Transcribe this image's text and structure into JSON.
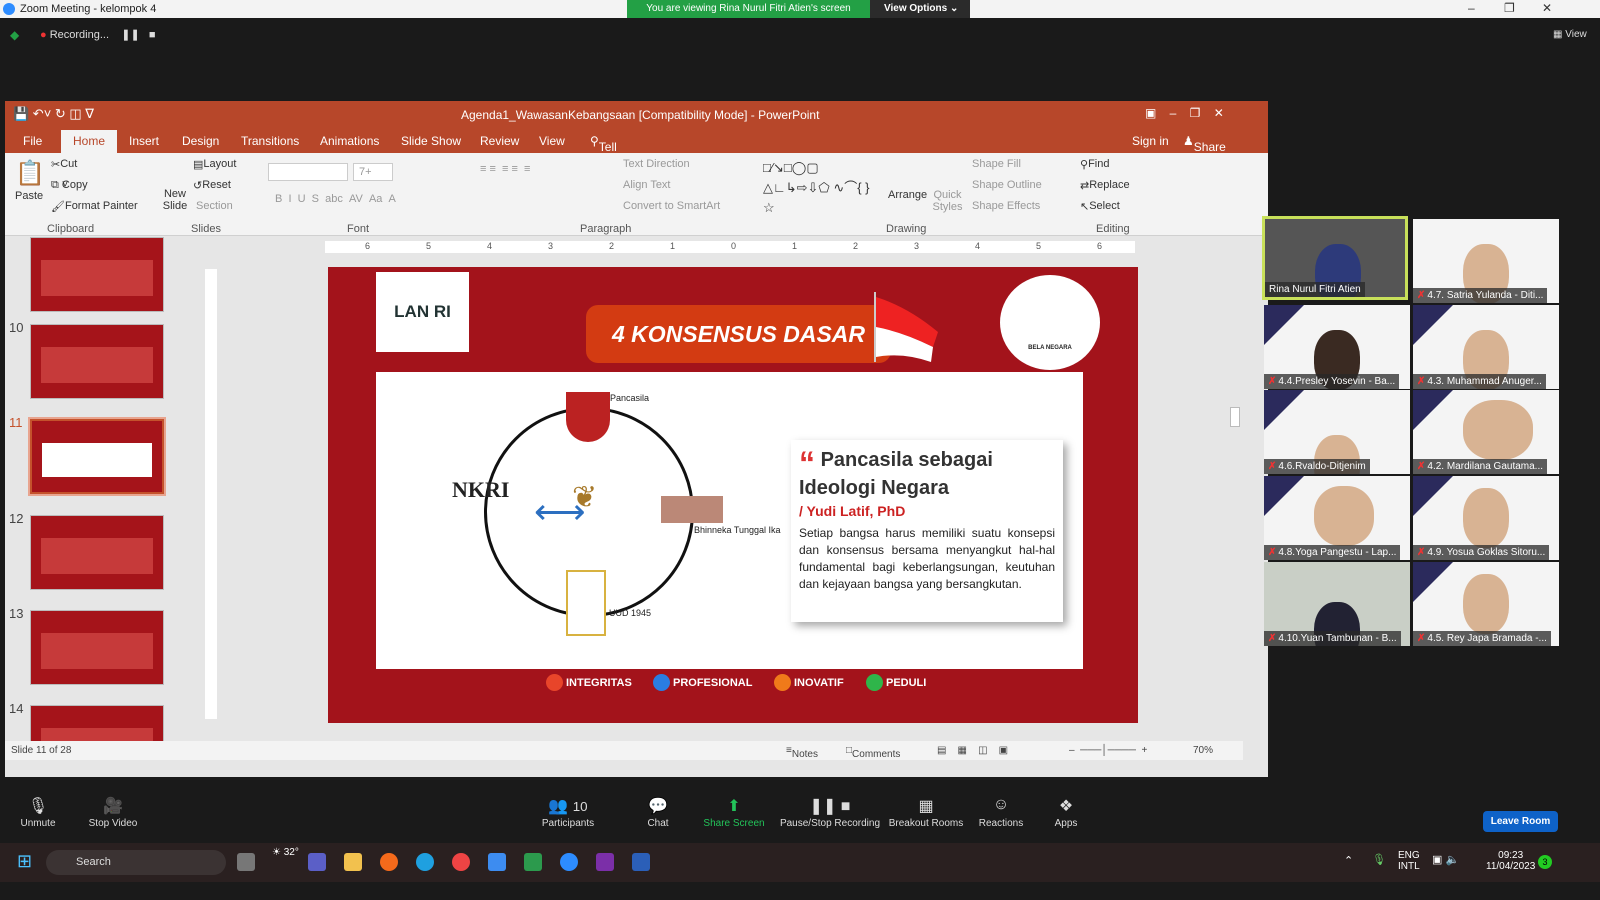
{
  "zoom": {
    "window_title": "Zoom Meeting - kelompok 4",
    "share_banner": "You are viewing Rina Nurul Fitri Atien's screen",
    "view_options": "View Options",
    "recording": "Recording...",
    "view": "View",
    "toolbar": [
      {
        "label": "Unmute",
        "icon": "mic-muted-icon"
      },
      {
        "label": "Stop Video",
        "icon": "video-icon"
      },
      {
        "label": "Participants",
        "icon": "participants-icon",
        "count": "10"
      },
      {
        "label": "Chat",
        "icon": "chat-icon"
      },
      {
        "label": "Share Screen",
        "icon": "share-screen-icon"
      },
      {
        "label": "Pause/Stop Recording",
        "icon": "recording-icon"
      },
      {
        "label": "Breakout Rooms",
        "icon": "breakout-icon"
      },
      {
        "label": "Reactions",
        "icon": "reactions-icon"
      },
      {
        "label": "Apps",
        "icon": "apps-icon"
      }
    ],
    "leave": "Leave Room",
    "participants": [
      "Rina Nurul Fitri Atien",
      "4.7. Satria Yulanda - Diti...",
      "4.4.Presley Yosevin - Ba...",
      "4.3. Muhammad Anuger...",
      "4.6.Rvaldo-Ditjenim",
      "4.2. Mardilana Gautama...",
      "4.8.Yoga Pangestu - Lap...",
      "4.9. Yosua Goklas Sitoru...",
      "4.10.Yuan Tambunan - B...",
      "4.5. Rey Japa Bramada -..."
    ]
  },
  "ppt": {
    "title": "Agenda1_WawasanKebangsaan [Compatibility Mode] - PowerPoint",
    "tabs": [
      "File",
      "Home",
      "Insert",
      "Design",
      "Transitions",
      "Animations",
      "Slide Show",
      "Review",
      "View",
      "Tell me what you want to do..."
    ],
    "signin": "Sign in",
    "share": "Share",
    "ribbon": {
      "paste": "Paste",
      "cut": "Cut",
      "copy": "Copy",
      "format_painter": "Format Painter",
      "new_slide": "New Slide",
      "layout": "Layout",
      "reset": "Reset",
      "section": "Section",
      "font_size": "7+",
      "text_direction": "Text Direction",
      "align_text": "Align Text",
      "convert": "Convert to SmartArt",
      "arrange": "Arrange",
      "quick_styles": "Quick Styles",
      "shape_fill": "Shape Fill",
      "shape_outline": "Shape Outline",
      "shape_effects": "Shape Effects",
      "find": "Find",
      "replace": "Replace",
      "select": "Select",
      "groups": [
        "Clipboard",
        "Slides",
        "Font",
        "Paragraph",
        "Drawing",
        "Editing"
      ]
    },
    "thumb_numbers": [
      "10",
      "11",
      "12",
      "13",
      "14"
    ],
    "ruler": [
      "6",
      "5",
      "4",
      "3",
      "2",
      "1",
      "0",
      "1",
      "2",
      "3",
      "4",
      "5",
      "6"
    ],
    "status": {
      "slide": "Slide 11 of 28",
      "notes": "Notes",
      "comments": "Comments",
      "zoom": "70%"
    }
  },
  "slide": {
    "logo": "LAN RI",
    "title": "4 KONSENSUS DASAR",
    "seal": "BELA NEGARA",
    "labels": {
      "pancasila": "Pancasila",
      "nkri": "NKRI",
      "bhinneka": "Bhinneka Tunggal Ika",
      "uud": "UUD 1945"
    },
    "quote_title": "Pancasila sebagai Ideologi Negara",
    "quote_author": "/ Yudi Latif, PhD",
    "quote_body": "Setiap bangsa harus memiliki suatu konsepsi dan konsensus bersama menyangkut hal-hal fundamental bagi keberlangsungan, keutuhan dan kejayaan bangsa yang bersangkutan.",
    "values": [
      {
        "label": "INTEGRITAS",
        "color": "#e8452a"
      },
      {
        "label": "PROFESIONAL",
        "color": "#2a7de1"
      },
      {
        "label": "INOVATIF",
        "color": "#f07a1a"
      },
      {
        "label": "PEDULI",
        "color": "#2fb54a"
      }
    ]
  },
  "taskbar": {
    "search": "Search",
    "temp": "32°",
    "lang": "ENG",
    "lang2": "INTL",
    "time": "09:23",
    "date": "11/04/2023",
    "notif": "3"
  }
}
